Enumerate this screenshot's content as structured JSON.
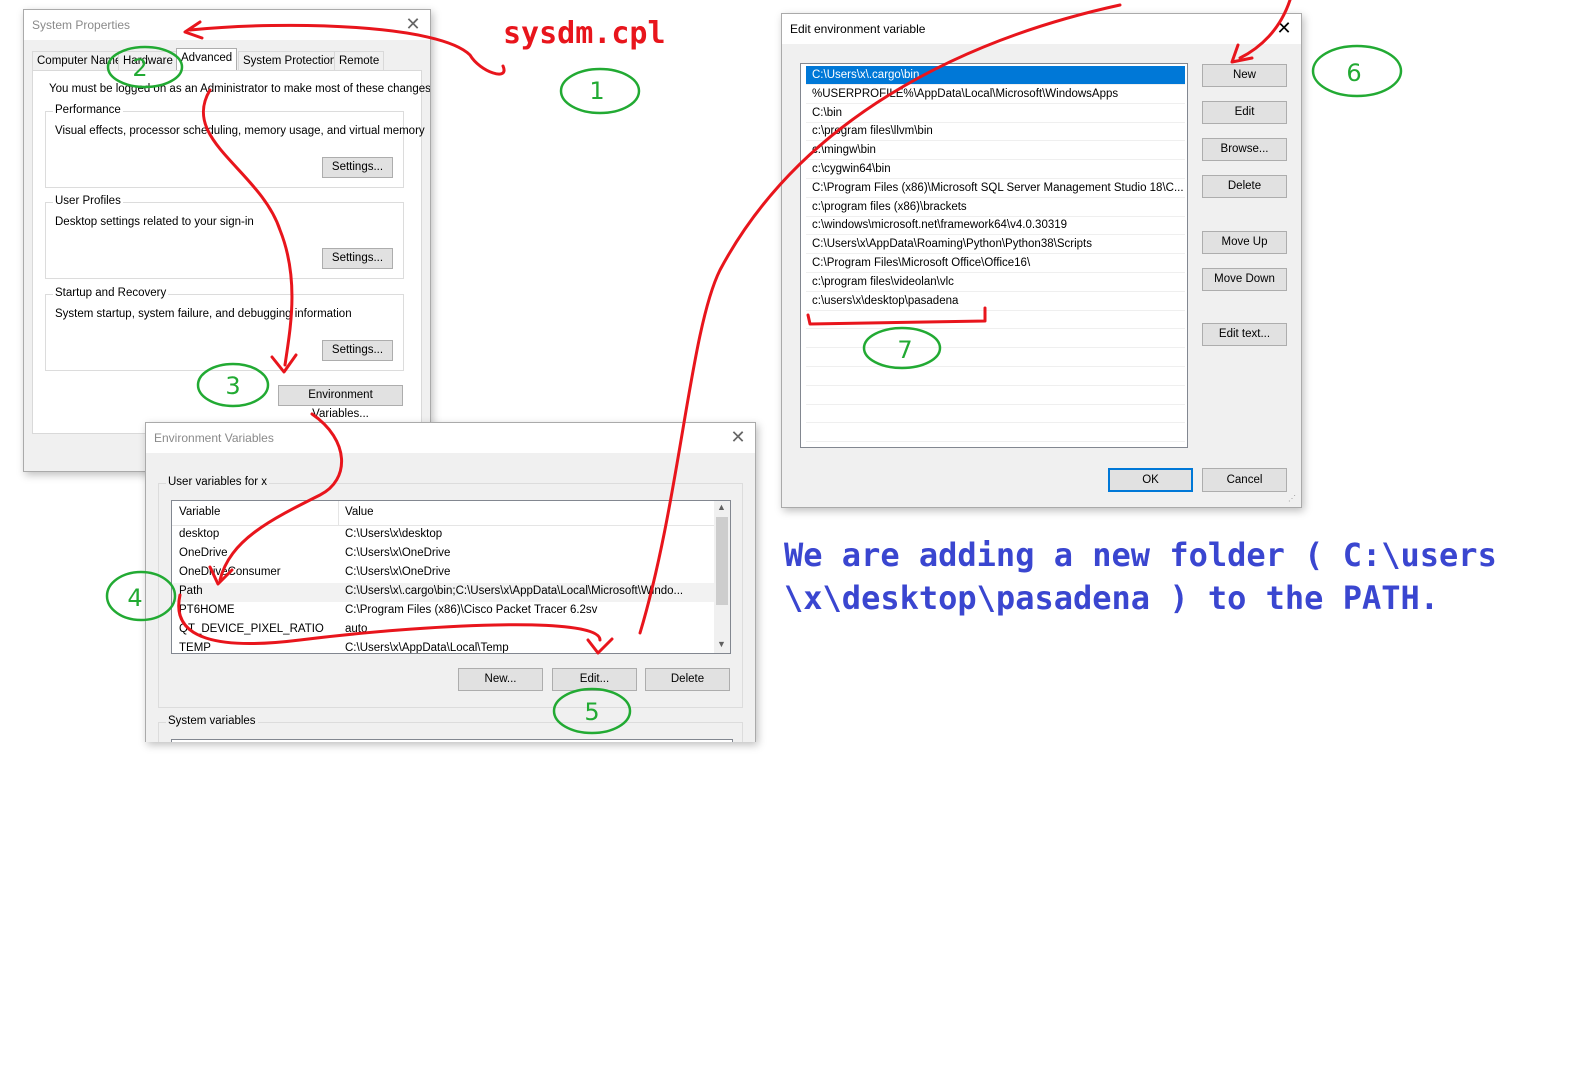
{
  "sysprops": {
    "title": "System Properties",
    "tabs": [
      "Computer Name",
      "Hardware",
      "Advanced",
      "System Protection",
      "Remote"
    ],
    "admin_note": "You must be logged on as an Administrator to make most of these changes.",
    "performance": {
      "label": "Performance",
      "desc": "Visual effects, processor scheduling, memory usage, and virtual memory",
      "button": "Settings..."
    },
    "profiles": {
      "label": "User Profiles",
      "desc": "Desktop settings related to your sign-in",
      "button": "Settings..."
    },
    "startup": {
      "label": "Startup and Recovery",
      "desc": "System startup, system failure, and debugging information",
      "button": "Settings..."
    },
    "env_button": "Environment Variables..."
  },
  "envvars": {
    "title": "Environment Variables",
    "user_group": "User variables for x",
    "col_variable": "Variable",
    "col_value": "Value",
    "rows": [
      {
        "var": "desktop",
        "val": "C:\\Users\\x\\desktop"
      },
      {
        "var": "OneDrive",
        "val": "C:\\Users\\x\\OneDrive"
      },
      {
        "var": "OneDriveConsumer",
        "val": "C:\\Users\\x\\OneDrive"
      },
      {
        "var": "Path",
        "val": "C:\\Users\\x\\.cargo\\bin;C:\\Users\\x\\AppData\\Local\\Microsoft\\Windo..."
      },
      {
        "var": "PT6HOME",
        "val": "C:\\Program Files (x86)\\Cisco Packet Tracer 6.2sv"
      },
      {
        "var": "QT_DEVICE_PIXEL_RATIO",
        "val": "auto"
      },
      {
        "var": "TEMP",
        "val": "C:\\Users\\x\\AppData\\Local\\Temp"
      }
    ],
    "buttons": {
      "new": "New...",
      "edit": "Edit...",
      "delete": "Delete"
    },
    "system_group": "System variables"
  },
  "editenv": {
    "title": "Edit environment variable",
    "entries": [
      "C:\\Users\\x\\.cargo\\bin",
      "%USERPROFILE%\\AppData\\Local\\Microsoft\\WindowsApps",
      "C:\\bin",
      "c:\\program files\\llvm\\bin",
      "c:\\mingw\\bin",
      "c:\\cygwin64\\bin",
      "C:\\Program Files (x86)\\Microsoft SQL Server Management Studio 18\\C...",
      "c:\\program files (x86)\\brackets",
      "c:\\windows\\microsoft.net\\framework64\\v4.0.30319",
      "C:\\Users\\x\\AppData\\Roaming\\Python\\Python38\\Scripts",
      "C:\\Program Files\\Microsoft Office\\Office16\\",
      "c:\\program files\\videolan\\vlc",
      "c:\\users\\x\\desktop\\pasadena"
    ],
    "buttons": {
      "new": "New",
      "edit": "Edit",
      "browse": "Browse...",
      "delete": "Delete",
      "move_up": "Move Up",
      "move_down": "Move Down",
      "edit_text": "Edit text...",
      "ok": "OK",
      "cancel": "Cancel"
    }
  },
  "annotations": {
    "command": "sysdm.cpl",
    "explanation_line1": "We are adding a new folder ( C:\\users",
    "explanation_line2": "\\x\\desktop\\pasadena ) to the PATH.",
    "steps": [
      "1",
      "2",
      "3",
      "4",
      "5",
      "6",
      "7"
    ],
    "colors": {
      "arrow": "#e8151c",
      "step": "#22aa33",
      "command": "#e8151c",
      "explanation": "#3a46d0",
      "selection": "#0078d7"
    }
  }
}
